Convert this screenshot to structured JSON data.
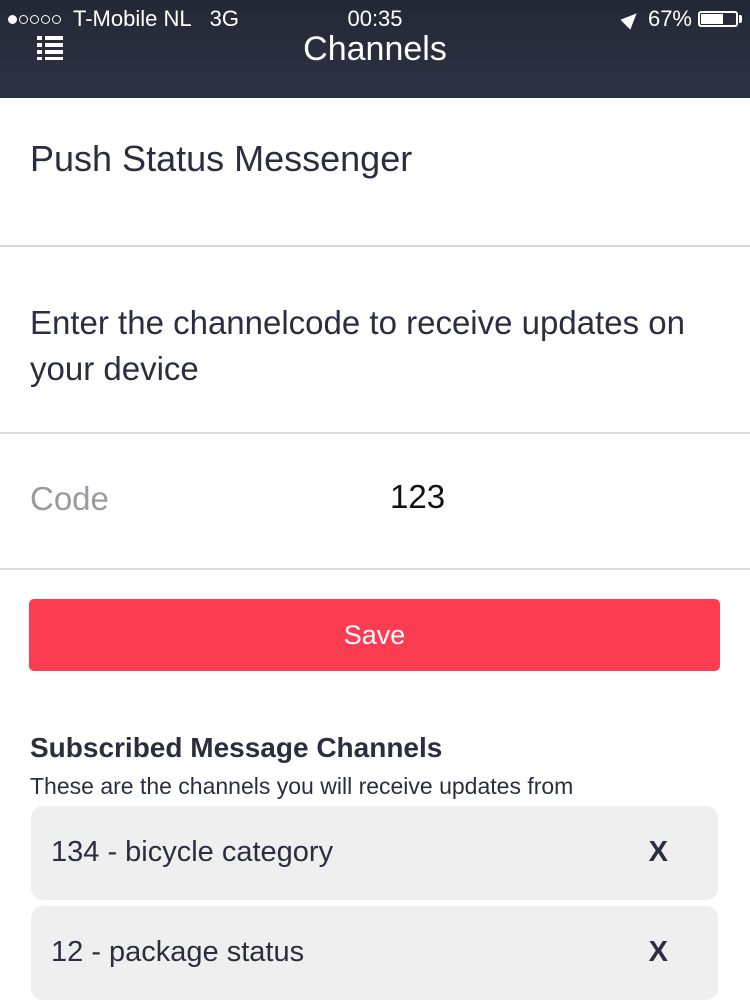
{
  "status_bar": {
    "carrier": "T-Mobile NL",
    "network": "3G",
    "time": "00:35",
    "battery": "67%",
    "battery_level": 0.67,
    "signal_bars": 1,
    "signal_total": 5
  },
  "nav": {
    "title": "Channels",
    "menu_icon": "list-menu-icon"
  },
  "app": {
    "title": "Push Status Messenger"
  },
  "instructions": "Enter the channelcode to receive updates on your device",
  "code_field": {
    "label": "Code",
    "value": "123"
  },
  "save_button": {
    "label": "Save",
    "color": "#fc3d51"
  },
  "subscriptions": {
    "heading": "Subscribed Message Channels",
    "subheading": "These are the channels you will receive updates from",
    "channels": [
      {
        "label": "134 - bicycle category",
        "remove": "X"
      },
      {
        "label": "12 - package status",
        "remove": "X"
      }
    ]
  },
  "colors": {
    "nav_background": "#2a2f3e",
    "text": "#2b2e3f",
    "placeholder": "#9a9aa0",
    "accent": "#fc3d51",
    "card_background": "#efeff0"
  }
}
